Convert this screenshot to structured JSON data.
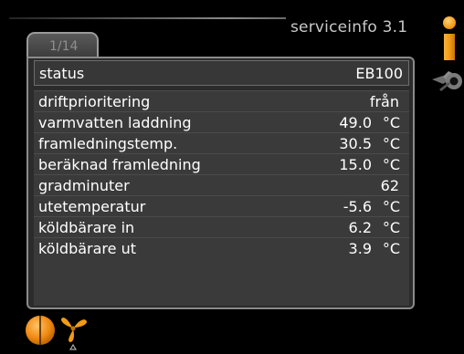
{
  "header": {
    "title": "serviceinfo 3.1"
  },
  "tab": {
    "label": "1/14"
  },
  "status": {
    "label": "status",
    "value": "EB100"
  },
  "rows": [
    {
      "label": "driftprioritering",
      "value": "från",
      "unit": ""
    },
    {
      "label": "varmvatten laddning",
      "value": "49.0",
      "unit": "°C"
    },
    {
      "label": "framledningstemp.",
      "value": "30.5",
      "unit": "°C"
    },
    {
      "label": "beräknad framledning",
      "value": "15.0",
      "unit": "°C"
    },
    {
      "label": "gradminuter",
      "value": "62",
      "unit": ""
    },
    {
      "label": "utetemperatur",
      "value": "-5.6",
      "unit": "°C"
    },
    {
      "label": "köldbärare in",
      "value": "6.2",
      "unit": "°C"
    },
    {
      "label": "köldbärare ut",
      "value": "3.9",
      "unit": "°C"
    }
  ],
  "icons": {
    "top_right": "info-icon",
    "side": "tools-icon",
    "bottom_left": "heating-dial-icon",
    "bottom_second": "fan-icon"
  },
  "colors": {
    "accent": "#f29b16",
    "background": "#000000",
    "panel": "#3a3a3a"
  }
}
